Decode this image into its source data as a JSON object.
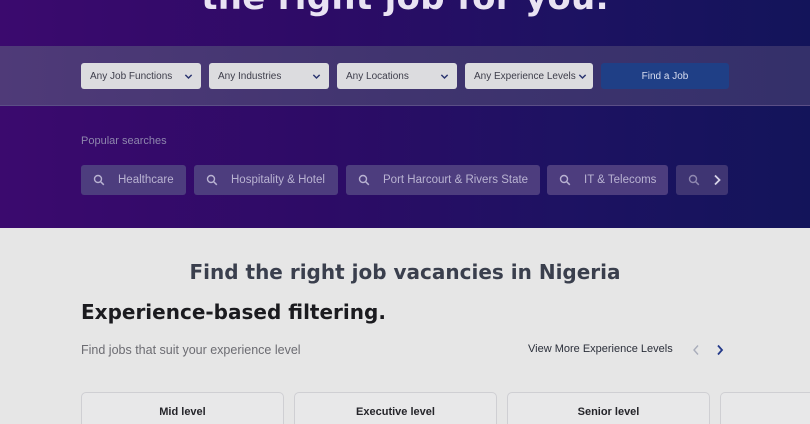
{
  "hero": {
    "title": "the right job for you."
  },
  "filters": {
    "job_functions": "Any Job Functions",
    "industries": "Any Industries",
    "locations": "Any Locations",
    "experience_levels": "Any Experience Levels",
    "find_button": "Find a Job"
  },
  "popular": {
    "label": "Popular searches",
    "chips": [
      "Healthcare",
      "Hospitality & Hotel",
      "Port Harcourt & Rivers State",
      "IT & Telecoms"
    ]
  },
  "main": {
    "section_title": "Find the right job vacancies in Nigeria",
    "experience_heading": "Experience-based filtering.",
    "experience_subtitle": "Find jobs that suit your experience level",
    "view_more": "View More Experience Levels",
    "levels": [
      "Mid level",
      "Executive level",
      "Senior level"
    ]
  },
  "colors": {
    "hero_bg": "#2d0b66",
    "primary_button": "#1f3f86"
  },
  "icons": {
    "select_chevron": "chevron-down-icon",
    "chip_search": "search-icon",
    "scroll_next": "chevron-right-icon",
    "nav_prev": "chevron-left-icon",
    "nav_next": "chevron-right-icon"
  }
}
